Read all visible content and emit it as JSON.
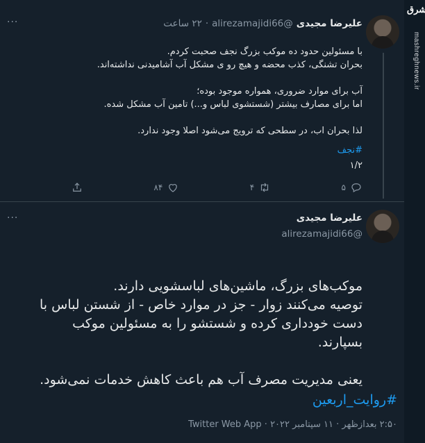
{
  "watermark": {
    "logo": "مشرق",
    "site": "mashreghnews.ir"
  },
  "tweet1": {
    "name": "علیرضا مجیدی",
    "handle": "@alirezamajidi66",
    "time": "۲۲ ساعت",
    "separator": "·",
    "menu": "···",
    "text": "با مسئولین حدود ده موکب بزرگ نجف صحبت کردم.\nبحران تشنگی، کذب محضه و هیچ رو ی مشکل آب آشامیدنی نداشته‌اند.\n\nآب برای موارد ضروری، همواره موجود بوده؛\nاما برای مصارف بیشتر (شستشوی لباس و...) تامین آب مشکل شده.\n\nلذا بحران اب، در سطحی که ترویج می‌شود اصلا وجود ندارد.",
    "hashtag": "#نجف",
    "thread_count": "۱/۲",
    "replies": "۵",
    "retweets": "۴",
    "likes": "۸۴"
  },
  "tweet2": {
    "name": "علیرضا مجیدی",
    "handle": "@alirezamajidi66",
    "menu": "···",
    "text": "موکب‌های بزرگ، ماشین‌های لباسشویی دارند.\nتوصیه می‌کنند زوار - جز در موارد خاص - از شستن لباس با دست خودداری کرده و شستشو را به مسئولین موکب بسپارند.\n\nیعنی مدیریت مصرف آب هم باعث کاهش خدمات نمی‌شود.",
    "hashtag": "#روایت_اربعین",
    "meta": "۲:۵۰ بعدازظهر · ۱۱ سپتامبر ۲۰۲۲ · Twitter Web App"
  }
}
